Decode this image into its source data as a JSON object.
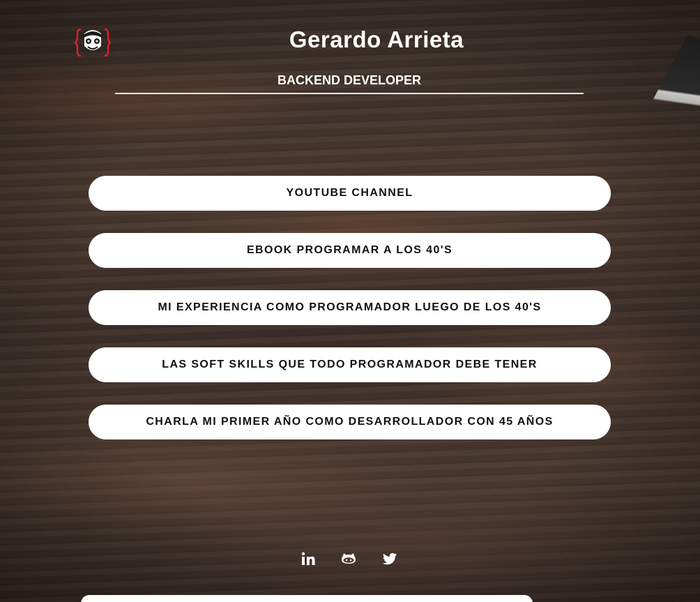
{
  "profile": {
    "name": "Gerardo Arrieta",
    "role": "BACKEND DEVELOPER"
  },
  "links": [
    {
      "label": "YOUTUBE CHANNEL"
    },
    {
      "label": "EBOOK PROGRAMAR A LOS 40'S"
    },
    {
      "label": "MI EXPERIENCIA COMO PROGRAMADOR LUEGO DE LOS 40'S"
    },
    {
      "label": "LAS SOFT SKILLS QUE TODO PROGRAMADOR DEBE TENER"
    },
    {
      "label": "CHARLA MI PRIMER AÑO COMO DESARROLLADOR CON 45 AÑOS"
    }
  ],
  "socials": [
    {
      "icon": "linkedin-icon"
    },
    {
      "icon": "github-icon"
    },
    {
      "icon": "twitter-icon"
    }
  ],
  "colors": {
    "button_bg": "#ffffff",
    "button_text": "#111111",
    "text": "#ffffff",
    "logo_accent": "#e0202a"
  }
}
